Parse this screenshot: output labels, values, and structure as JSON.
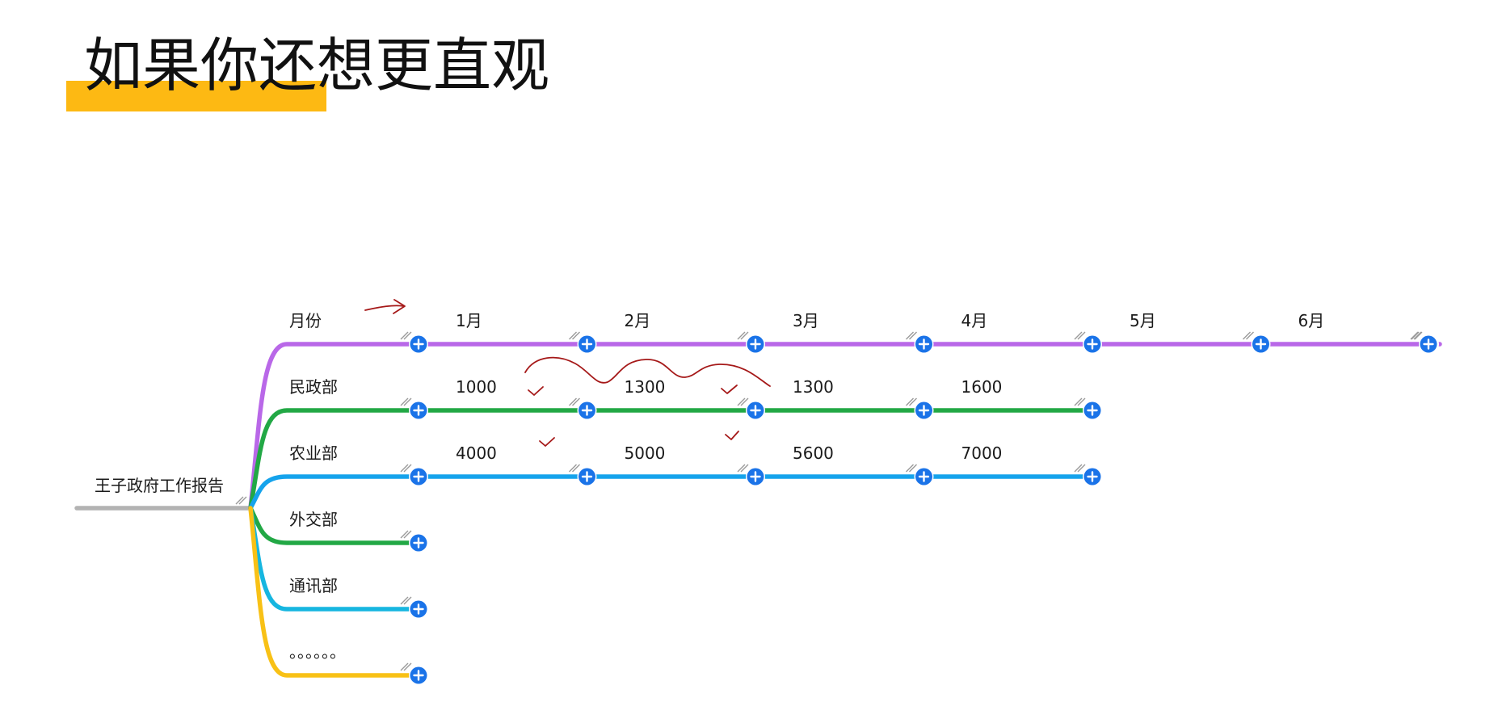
{
  "heading": {
    "text": "如果你还想更直观",
    "highlight_color": "#FDB913"
  },
  "mindmap": {
    "root": "王子政府工作报告",
    "root_color": "#b3b3b3",
    "node_color": "#1a73e8",
    "branches": [
      {
        "id": "month",
        "label": "月份",
        "color": "#B968E8",
        "cells": [
          "1月",
          "2月",
          "3月",
          "4月",
          "5月",
          "6月"
        ]
      },
      {
        "id": "civil",
        "label": "民政部",
        "color": "#22A845",
        "cells": [
          "1000",
          "1300",
          "1300",
          "1600"
        ]
      },
      {
        "id": "agri",
        "label": "农业部",
        "color": "#15A3EC",
        "cells": [
          "4000",
          "5000",
          "5600",
          "7000"
        ]
      },
      {
        "id": "foreign",
        "label": "外交部",
        "color": "#22A845",
        "cells": []
      },
      {
        "id": "telecom",
        "label": "通讯部",
        "color": "#16B6E0",
        "cells": []
      },
      {
        "id": "more",
        "label": "。。。。。。",
        "color": "#F8C116",
        "cells": []
      }
    ],
    "annotation_color": "#A51818"
  }
}
